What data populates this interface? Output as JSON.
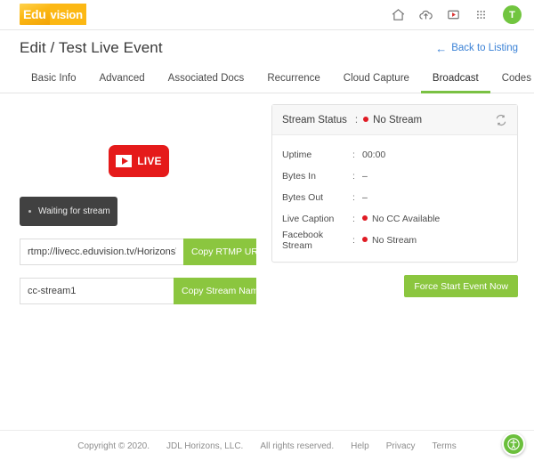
{
  "topbar": {
    "logo": {
      "part1": "Edu",
      "part2": "vision"
    },
    "icons": [
      {
        "name": "home-icon"
      },
      {
        "name": "cloud-upload-icon"
      },
      {
        "name": "video-play-icon"
      },
      {
        "name": "apps-grid-icon"
      }
    ],
    "avatar_initial": "T"
  },
  "header": {
    "title": "Edit / Test Live Event",
    "back_label": "Back to Listing",
    "back_arrow": "←"
  },
  "tabs": [
    {
      "label": "Basic Info",
      "active": false
    },
    {
      "label": "Advanced",
      "active": false
    },
    {
      "label": "Associated Docs",
      "active": false
    },
    {
      "label": "Recurrence",
      "active": false
    },
    {
      "label": "Cloud Capture",
      "active": false
    },
    {
      "label": "Broadcast",
      "active": true
    },
    {
      "label": "Codes",
      "active": false
    }
  ],
  "broadcast": {
    "live_badge_text": "LIVE",
    "waiting_text": "Waiting for stream",
    "rtmp_url": {
      "value": "rtmp://livecc.eduvision.tv/HorizonsVP",
      "placeholder": "RTMP URL",
      "button_label": "Copy RTMP URL"
    },
    "stream_name": {
      "value": "cc-stream1",
      "placeholder": "Stream Name",
      "button_label": "Copy Stream Name"
    }
  },
  "status_panel": {
    "header": {
      "label": "Stream Status",
      "separator": ":",
      "value": "No Stream",
      "has_dot": true
    },
    "rows": [
      {
        "label": "Uptime",
        "separator": ":",
        "value": "00:00",
        "has_dot": false
      },
      {
        "label": "Bytes In",
        "separator": ":",
        "value": "–",
        "has_dot": false
      },
      {
        "label": "Bytes Out",
        "separator": ":",
        "value": "–",
        "has_dot": false
      },
      {
        "label": "Live Caption",
        "separator": ":",
        "value": "No CC Available",
        "has_dot": true
      },
      {
        "label": "Facebook Stream",
        "separator": ":",
        "value": "No Stream",
        "has_dot": true
      }
    ],
    "force_start_label": "Force Start Event Now"
  },
  "footer": {
    "copyright": "Copyright © 2020.",
    "company": "JDL Horizons, LLC.",
    "rights": "All rights reserved.",
    "links": [
      {
        "label": "Help"
      },
      {
        "label": "Privacy"
      },
      {
        "label": "Terms"
      }
    ]
  },
  "colors": {
    "green": "#8bc63f",
    "green_tab": "#7ac143",
    "red": "#e01b24",
    "live_red": "#e51a1a",
    "blue_link": "#3b82d6",
    "dark_box": "#414141",
    "logo_gold": "#fcb814"
  }
}
